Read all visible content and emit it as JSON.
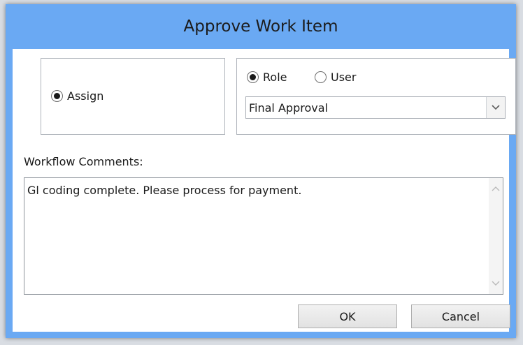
{
  "window": {
    "title": "Approve Work Item"
  },
  "assign_group": {
    "assign_label": "Assign",
    "assign_selected": true
  },
  "target_group": {
    "role_label": "Role",
    "role_selected": true,
    "user_label": "User",
    "user_selected": false,
    "dropdown_value": "Final Approval"
  },
  "comments": {
    "label": "Workflow Comments:",
    "text": "Gl coding complete. Please process for payment."
  },
  "buttons": {
    "ok_label": "OK",
    "cancel_label": "Cancel"
  },
  "icons": {
    "dropdown": "chevron-down-icon",
    "scroll_up": "chevron-up-icon",
    "scroll_down": "chevron-down-icon"
  },
  "colors": {
    "title_bar": "#6aa9f3",
    "client_bg": "#ffffff",
    "border": "#aeb3ba"
  }
}
